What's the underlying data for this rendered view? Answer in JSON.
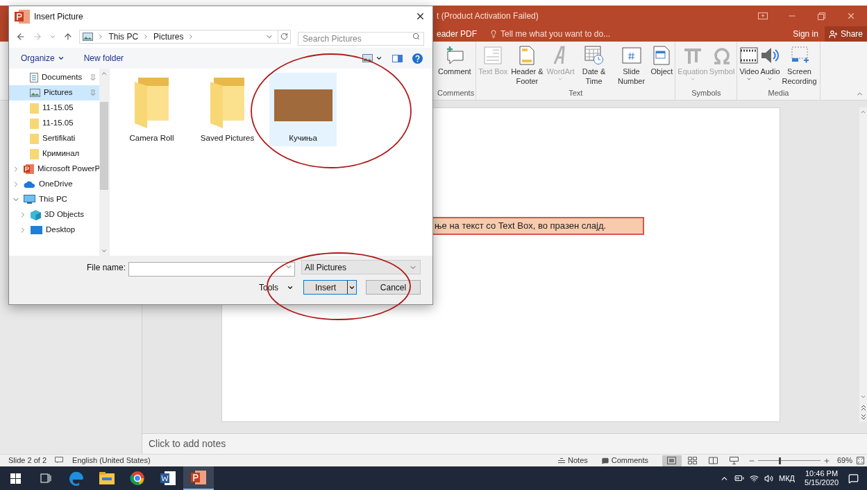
{
  "powerpoint": {
    "title": "t (Product Activation Failed)",
    "ribbon_tab": "eader PDF",
    "tell_me": "Tell me what you want to do...",
    "sign_in": "Sign in",
    "share": "Share",
    "ribbon_groups": [
      {
        "label": "Comments",
        "buttons": [
          {
            "kind": "comment",
            "label": "Comment",
            "disabled": false,
            "dropdown": false
          }
        ]
      },
      {
        "label": "Text",
        "buttons": [
          {
            "kind": "textbox",
            "label": "Text Box",
            "disabled": true,
            "dropdown": false
          },
          {
            "kind": "header",
            "label": "Header & Footer",
            "disabled": false,
            "dropdown": false
          },
          {
            "kind": "wordart",
            "label": "WordArt",
            "disabled": true,
            "dropdown": true
          },
          {
            "kind": "datetime",
            "label": "Date & Time",
            "disabled": false,
            "dropdown": false
          },
          {
            "kind": "slidenumber",
            "label": "Slide Number",
            "disabled": false,
            "dropdown": false
          },
          {
            "kind": "object",
            "label": "Object",
            "disabled": false,
            "dropdown": false
          }
        ]
      },
      {
        "label": "Symbols",
        "buttons": [
          {
            "kind": "equation",
            "label": "Equation",
            "disabled": true,
            "dropdown": true
          },
          {
            "kind": "symbol",
            "label": "Symbol",
            "disabled": true,
            "dropdown": false
          }
        ]
      },
      {
        "label": "Media",
        "buttons": [
          {
            "kind": "video",
            "label": "Video",
            "disabled": false,
            "dropdown": true
          },
          {
            "kind": "audio",
            "label": "Audio",
            "disabled": false,
            "dropdown": true
          },
          {
            "kind": "screenrec",
            "label": "Screen Recording",
            "disabled": false,
            "dropdown": false
          }
        ]
      }
    ],
    "slide_text": "ње на текст со Text Box,  во празен слајд.",
    "notes_placeholder": "Click to add notes",
    "status_bar": {
      "slide": "Slide 2 of 2",
      "language": "English (United States)",
      "notes": "Notes",
      "comments": "Comments",
      "zoom": "69%",
      "zoom_slider": {
        "level": 0.35
      },
      "views": [
        {
          "kind": "normal",
          "selected": true
        },
        {
          "kind": "sorter",
          "selected": false
        },
        {
          "kind": "reading",
          "selected": false
        },
        {
          "kind": "slideshow",
          "selected": false
        }
      ]
    }
  },
  "dialog": {
    "title": "Insert Picture",
    "breadcrumb": [
      "This PC",
      "Pictures"
    ],
    "search_placeholder": "Search Pictures",
    "organize": "Organize",
    "new_folder": "New folder",
    "nav": [
      {
        "kind": "document",
        "label": "Documents",
        "pinned": true,
        "selected": false
      },
      {
        "kind": "picture",
        "label": "Pictures",
        "pinned": true,
        "selected": true
      },
      {
        "kind": "folder",
        "label": "11-15.05",
        "pinned": false,
        "selected": false
      },
      {
        "kind": "folder",
        "label": "11-15.05",
        "pinned": false,
        "selected": false
      },
      {
        "kind": "folder",
        "label": "Sertifikati",
        "pinned": false,
        "selected": false
      },
      {
        "kind": "folder",
        "label": "Криминал",
        "pinned": false,
        "selected": false
      },
      {
        "kind": "powerpoint",
        "label": "Microsoft PowerP",
        "selected": false,
        "expanded": false
      },
      {
        "kind": "onedrive",
        "label": "OneDrive",
        "selected": false,
        "expanded": false
      },
      {
        "kind": "pc",
        "label": "This PC",
        "selected": false,
        "expanded": true,
        "children": [
          {
            "kind": "objects3d",
            "label": "3D Objects",
            "selected": false,
            "expanded": false
          },
          {
            "kind": "desktop",
            "label": "Desktop",
            "selected": false,
            "expanded": false
          }
        ]
      }
    ],
    "files": [
      {
        "kind": "folder",
        "name": "Camera Roll",
        "selected": false
      },
      {
        "kind": "folder",
        "name": "Saved Pictures",
        "selected": false
      },
      {
        "kind": "image",
        "name": "Кучиња",
        "selected": true
      }
    ],
    "file_name_label": "File name:",
    "file_type": "All Pictures",
    "tools": "Tools",
    "insert": "Insert",
    "cancel": "Cancel"
  },
  "taskbar": {
    "apps": [
      {
        "kind": "taskview",
        "selected": false
      },
      {
        "kind": "edge",
        "selected": false
      },
      {
        "kind": "explorer",
        "selected": false
      },
      {
        "kind": "chrome",
        "selected": false
      },
      {
        "kind": "word",
        "selected": false
      },
      {
        "kind": "powerpoint",
        "selected": true
      }
    ],
    "language": "МКД",
    "time": "10:46 PM",
    "date": "5/15/2020"
  }
}
